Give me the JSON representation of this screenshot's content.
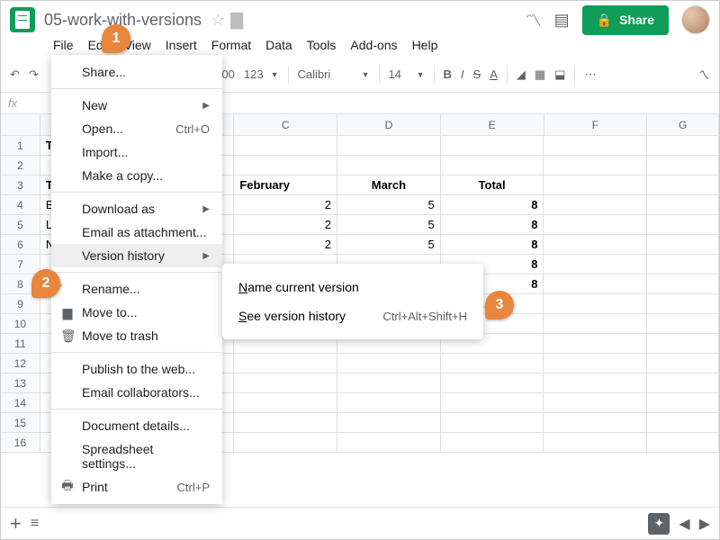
{
  "doc": {
    "title": "05-work-with-versions"
  },
  "menubar": [
    "File",
    "Edit",
    "View",
    "Insert",
    "Format",
    "Data",
    "Tools",
    "Add-ons",
    "Help"
  ],
  "toolbar": {
    "decimal": ".00",
    "numfmt": "123",
    "font": "Calibri",
    "size": "14"
  },
  "share_label": "Share",
  "fx_label": "fx",
  "columns": [
    "C",
    "D",
    "E",
    "F",
    "G"
  ],
  "row_numbers": [
    "1",
    "2",
    "3",
    "4",
    "5",
    "6",
    "7",
    "8",
    "9",
    "10",
    "11",
    "12",
    "13",
    "14",
    "15",
    "16"
  ],
  "cells": {
    "a1": "Tr",
    "a3": "Tr",
    "c3": "February",
    "d3": "March",
    "e3": "Total",
    "a4": "Bo",
    "c4": "2",
    "d4": "5",
    "e4": "8",
    "a5": "Lo",
    "c5": "2",
    "d5": "5",
    "e5": "8",
    "a6": "Ne",
    "c6": "2",
    "d6": "5",
    "e6": "8",
    "e7": "8",
    "e8": "8"
  },
  "file_menu": {
    "share": "Share...",
    "new": "New",
    "open": "Open...",
    "open_sc": "Ctrl+O",
    "import": "Import...",
    "copy": "Make a copy...",
    "download": "Download as",
    "email_attach": "Email as attachment...",
    "version": "Version history",
    "rename": "Rename...",
    "move": "Move to...",
    "trash": "Move to trash",
    "publish": "Publish to the web...",
    "email_collab": "Email collaborators...",
    "details": "Document details...",
    "settings": "Spreadsheet settings...",
    "print": "Print",
    "print_sc": "Ctrl+P"
  },
  "version_submenu": {
    "name": "Name current version",
    "see": "See version history",
    "see_sc": "Ctrl+Alt+Shift+H"
  },
  "bubbles": {
    "b1": "1",
    "b2": "2",
    "b3": "3"
  }
}
